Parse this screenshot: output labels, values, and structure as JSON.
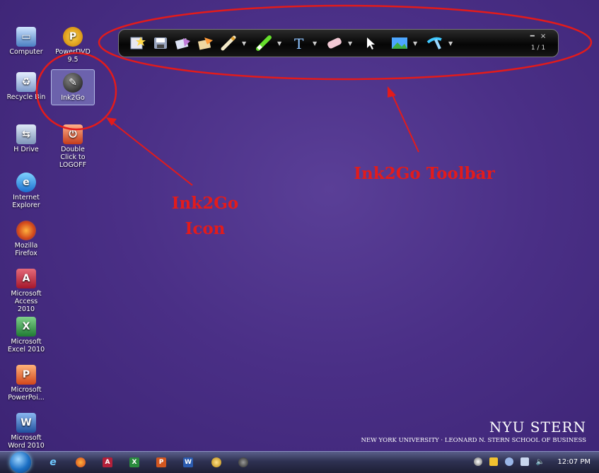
{
  "desktop_icons": [
    {
      "label": "Computer"
    },
    {
      "label": "PowerDVD 9.5"
    },
    {
      "label": "Recycle Bin"
    },
    {
      "label": "Ink2Go"
    },
    {
      "label": "H Drive"
    },
    {
      "label": "Double Click to LOGOFF"
    },
    {
      "label": "Internet Explorer"
    },
    {
      "label": "Mozilla Firefox"
    },
    {
      "label": "Microsoft Access 2010"
    },
    {
      "label": "Microsoft Excel 2010"
    },
    {
      "label": "Microsoft PowerPoi..."
    },
    {
      "label": "Microsoft Word 2010"
    }
  ],
  "toolbar": {
    "buttons": [
      "new-page-icon",
      "save-icon",
      "screen-capture-icon",
      "open-icon",
      "pen-icon",
      "highlighter-icon",
      "text-icon",
      "eraser-icon",
      "pointer-icon",
      "background-icon",
      "more-tools-icon"
    ],
    "page_indicator": "1 / 1",
    "minimize": "━",
    "close": "×"
  },
  "annotations": {
    "toolbar_label": "Ink2Go Toolbar",
    "icon_label_line1": "Ink2Go",
    "icon_label_line2": "Icon",
    "color": "#e31b1b"
  },
  "logo": {
    "main": "NYU STERN",
    "sub": "NEW YORK UNIVERSITY · LEONARD N. STERN SCHOOL OF BUSINESS"
  },
  "taskbar": {
    "apps": [
      "internet-explorer",
      "firefox",
      "access",
      "excel",
      "powerpoint",
      "word",
      "program-7",
      "program-8"
    ],
    "clock": "12:07 PM"
  }
}
